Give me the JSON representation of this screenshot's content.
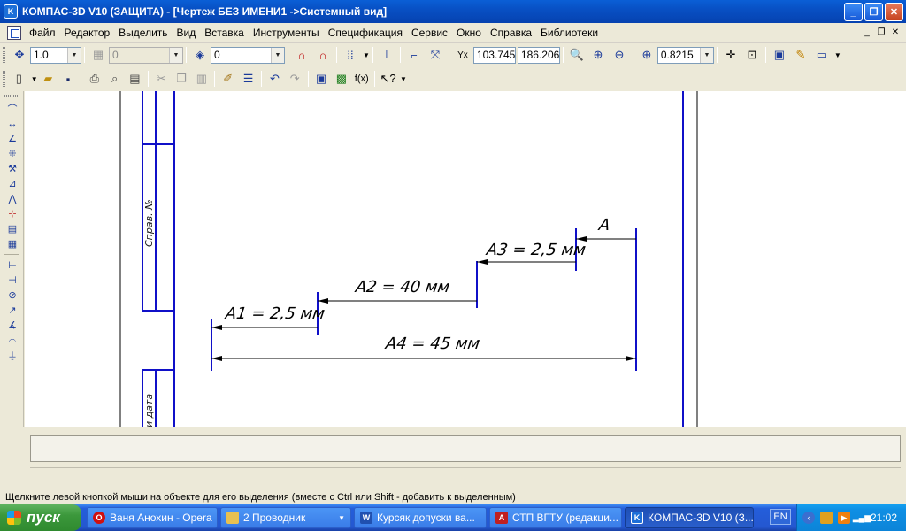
{
  "window": {
    "app_icon_label": "K",
    "title": "КОМПАС-3D V10 (ЗАЩИТА) - [Чертеж БЕЗ ИМЕНИ1 ->Системный вид]",
    "minimize": "_",
    "maximize": "❐",
    "close": "✕"
  },
  "menu": {
    "items": [
      "Файл",
      "Редактор",
      "Выделить",
      "Вид",
      "Вставка",
      "Инструменты",
      "Спецификация",
      "Сервис",
      "Окно",
      "Справка",
      "Библиотеки"
    ],
    "doc_controls": [
      "_",
      "❐",
      "✕"
    ]
  },
  "toolbar1": {
    "line_scale": "1.0",
    "layer": "0",
    "style": "0",
    "coord_label": "Yx",
    "coord_x": "103.745",
    "coord_y": "186.206",
    "zoom": "0.8215"
  },
  "drawing": {
    "dimensions": {
      "a": "A",
      "a1": "A1 = 2,5 мм",
      "a2": "A2 = 40 мм",
      "a3": "A3 = 2,5 мм",
      "a4": "A4 = 45 мм"
    },
    "stamp": {
      "sprav": "Справ. №",
      "data": "и дата"
    }
  },
  "status": {
    "hint": "Щелкните левой кнопкой мыши на объекте для его выделения (вместе с Ctrl или Shift - добавить к выделенным)"
  },
  "taskbar": {
    "start": "пуск",
    "items": [
      {
        "label": "Ваня Анохин - Opera",
        "icon": "opera-icon"
      },
      {
        "label": "2 Проводник",
        "icon": "folder-icon"
      },
      {
        "label": "Курсяк допуски ва...",
        "icon": "word-icon"
      },
      {
        "label": "СТП ВГТУ (редакци...",
        "icon": "pdf-icon"
      },
      {
        "label": "КОМПАС-3D V10 (З...",
        "icon": "kompas-icon"
      }
    ],
    "lang": "EN",
    "clock": "21:02"
  },
  "colors": {
    "titlebar": "#0850c4",
    "drawing_lines": "#1010c8",
    "canvas": "#ffffff"
  }
}
